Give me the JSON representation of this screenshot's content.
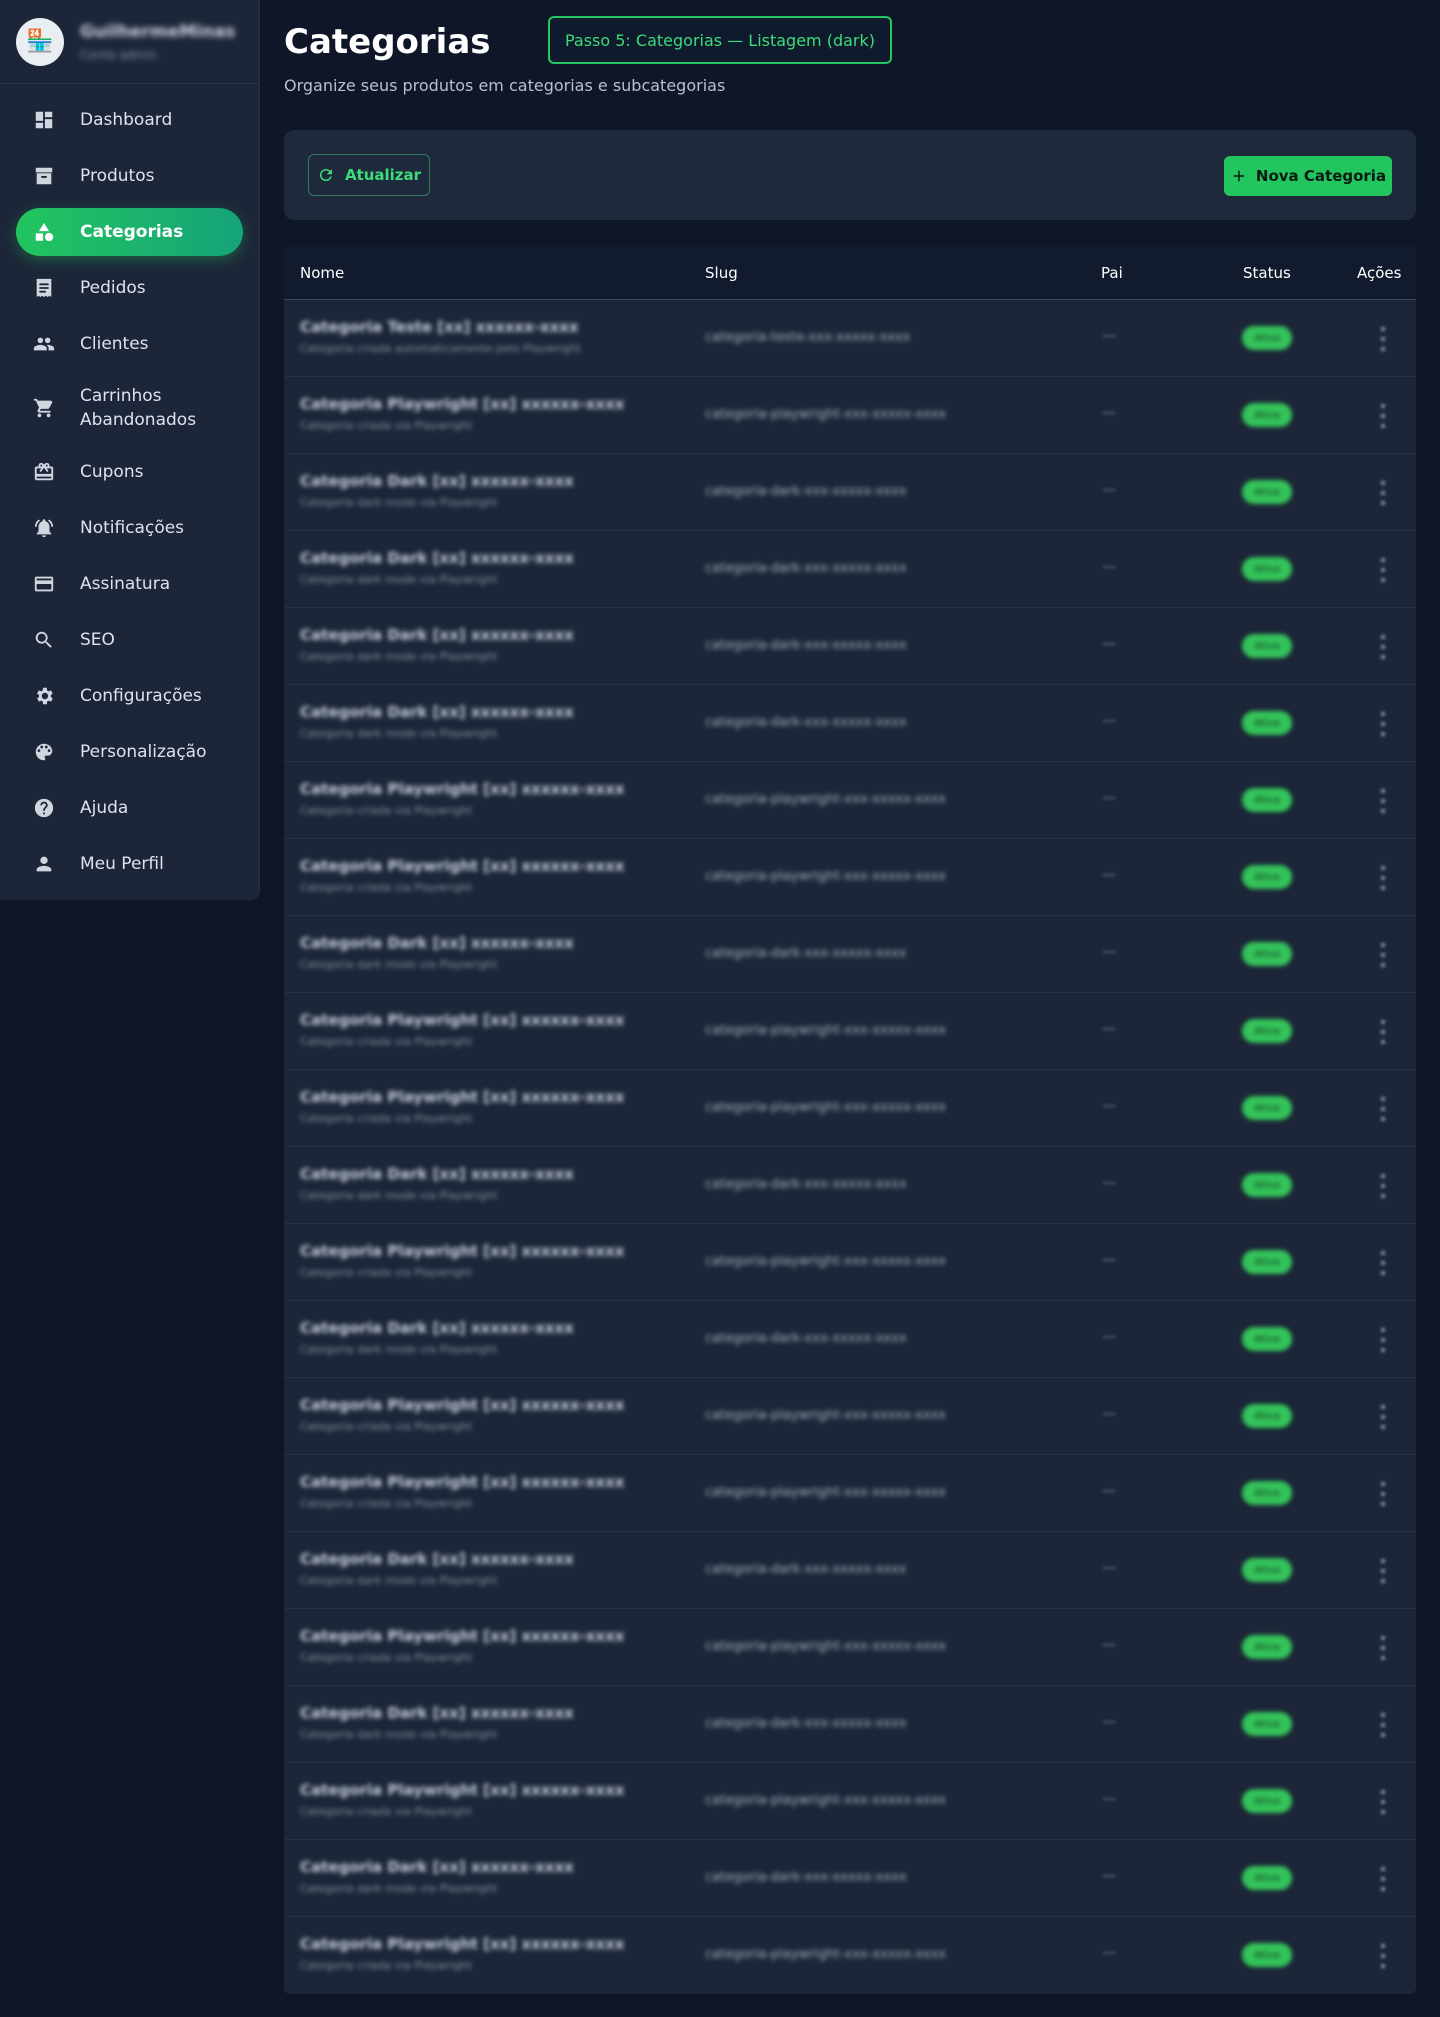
{
  "brand": {
    "name": "GuilhermeMinas",
    "subtitle": "Conta admin",
    "logo_icon": "store-logo"
  },
  "sidebar": {
    "items": [
      {
        "label": "Dashboard",
        "icon": "dashboard-icon",
        "active": false
      },
      {
        "label": "Produtos",
        "icon": "archive-icon",
        "active": false
      },
      {
        "label": "Categorias",
        "icon": "category-icon",
        "active": true
      },
      {
        "label": "Pedidos",
        "icon": "receipt-icon",
        "active": false
      },
      {
        "label": "Clientes",
        "icon": "people-icon",
        "active": false
      },
      {
        "label": "Carrinhos Abandonados",
        "icon": "cart-icon",
        "active": false
      },
      {
        "label": "Cupons",
        "icon": "gift-card-icon",
        "active": false
      },
      {
        "label": "Notificações",
        "icon": "bell-icon",
        "active": false
      },
      {
        "label": "Assinatura",
        "icon": "credit-card-icon",
        "active": false
      },
      {
        "label": "SEO",
        "icon": "search-icon",
        "active": false
      },
      {
        "label": "Configurações",
        "icon": "gear-icon",
        "active": false
      },
      {
        "label": "Personalização",
        "icon": "palette-icon",
        "active": false
      },
      {
        "label": "Ajuda",
        "icon": "help-icon",
        "active": false
      },
      {
        "label": "Meu Perfil",
        "icon": "person-icon",
        "active": false
      }
    ]
  },
  "header": {
    "title": "Categorias",
    "subtitle": "Organize seus produtos em categorias e subcategorias",
    "step_badge": "Passo 5: Categorias — Listagem (dark)"
  },
  "toolbar": {
    "refresh_label": "Atualizar",
    "new_label": "Nova Categoria"
  },
  "table": {
    "columns": [
      "Nome",
      "Slug",
      "Pai",
      "Status",
      "Ações"
    ],
    "rows": [
      {
        "name": "Categoria Teste [xx] xxxxxx-xxxx",
        "description": "Categoria criada automaticamente pelo Playwright",
        "slug": "categoria-teste-xxx-xxxxx-xxxx",
        "parent": "—",
        "status": "Ativa"
      },
      {
        "name": "Categoria Playwright [xx] xxxxxx-xxxx",
        "description": "Categoria criada via Playwright",
        "slug": "categoria-playwright-xxx-xxxxx-xxxx",
        "parent": "—",
        "status": "Ativa"
      },
      {
        "name": "Categoria Dark [xx] xxxxxx-xxxx",
        "description": "Categoria dark mode via Playwright",
        "slug": "categoria-dark-xxx-xxxxx-xxxx",
        "parent": "—",
        "status": "Ativa"
      },
      {
        "name": "Categoria Dark [xx] xxxxxx-xxxx",
        "description": "Categoria dark mode via Playwright",
        "slug": "categoria-dark-xxx-xxxxx-xxxx",
        "parent": "—",
        "status": "Ativa"
      },
      {
        "name": "Categoria Dark [xx] xxxxxx-xxxx",
        "description": "Categoria dark mode via Playwright",
        "slug": "categoria-dark-xxx-xxxxx-xxxx",
        "parent": "—",
        "status": "Ativa"
      },
      {
        "name": "Categoria Dark [xx] xxxxxx-xxxx",
        "description": "Categoria dark mode via Playwright",
        "slug": "categoria-dark-xxx-xxxxx-xxxx",
        "parent": "—",
        "status": "Ativa"
      },
      {
        "name": "Categoria Playwright [xx] xxxxxx-xxxx",
        "description": "Categoria criada via Playwright",
        "slug": "categoria-playwright-xxx-xxxxx-xxxx",
        "parent": "—",
        "status": "Ativa"
      },
      {
        "name": "Categoria Playwright [xx] xxxxxx-xxxx",
        "description": "Categoria criada via Playwright",
        "slug": "categoria-playwright-xxx-xxxxx-xxxx",
        "parent": "—",
        "status": "Ativa"
      },
      {
        "name": "Categoria Dark [xx] xxxxxx-xxxx",
        "description": "Categoria dark mode via Playwright",
        "slug": "categoria-dark-xxx-xxxxx-xxxx",
        "parent": "—",
        "status": "Ativa"
      },
      {
        "name": "Categoria Playwright [xx] xxxxxx-xxxx",
        "description": "Categoria criada via Playwright",
        "slug": "categoria-playwright-xxx-xxxxx-xxxx",
        "parent": "—",
        "status": "Ativa"
      },
      {
        "name": "Categoria Playwright [xx] xxxxxx-xxxx",
        "description": "Categoria criada via Playwright",
        "slug": "categoria-playwright-xxx-xxxxx-xxxx",
        "parent": "—",
        "status": "Ativa"
      },
      {
        "name": "Categoria Dark [xx] xxxxxx-xxxx",
        "description": "Categoria dark mode via Playwright",
        "slug": "categoria-dark-xxx-xxxxx-xxxx",
        "parent": "—",
        "status": "Ativa"
      },
      {
        "name": "Categoria Playwright [xx] xxxxxx-xxxx",
        "description": "Categoria criada via Playwright",
        "slug": "categoria-playwright-xxx-xxxxx-xxxx",
        "parent": "—",
        "status": "Ativa"
      },
      {
        "name": "Categoria Dark [xx] xxxxxx-xxxx",
        "description": "Categoria dark mode via Playwright",
        "slug": "categoria-dark-xxx-xxxxx-xxxx",
        "parent": "—",
        "status": "Ativa"
      },
      {
        "name": "Categoria Playwright [xx] xxxxxx-xxxx",
        "description": "Categoria criada via Playwright",
        "slug": "categoria-playwright-xxx-xxxxx-xxxx",
        "parent": "—",
        "status": "Ativa"
      },
      {
        "name": "Categoria Playwright [xx] xxxxxx-xxxx",
        "description": "Categoria criada via Playwright",
        "slug": "categoria-playwright-xxx-xxxxx-xxxx",
        "parent": "—",
        "status": "Ativa"
      },
      {
        "name": "Categoria Dark [xx] xxxxxx-xxxx",
        "description": "Categoria dark mode via Playwright",
        "slug": "categoria-dark-xxx-xxxxx-xxxx",
        "parent": "—",
        "status": "Ativa"
      },
      {
        "name": "Categoria Playwright [xx] xxxxxx-xxxx",
        "description": "Categoria criada via Playwright",
        "slug": "categoria-playwright-xxx-xxxxx-xxxx",
        "parent": "—",
        "status": "Ativa"
      },
      {
        "name": "Categoria Dark [xx] xxxxxx-xxxx",
        "description": "Categoria dark mode via Playwright",
        "slug": "categoria-dark-xxx-xxxxx-xxxx",
        "parent": "—",
        "status": "Ativa"
      },
      {
        "name": "Categoria Playwright [xx] xxxxxx-xxxx",
        "description": "Categoria criada via Playwright",
        "slug": "categoria-playwright-xxx-xxxxx-xxxx",
        "parent": "—",
        "status": "Ativa"
      },
      {
        "name": "Categoria Dark [xx] xxxxxx-xxxx",
        "description": "Categoria dark mode via Playwright",
        "slug": "categoria-dark-xxx-xxxxx-xxxx",
        "parent": "—",
        "status": "Ativa"
      },
      {
        "name": "Categoria Playwright [xx] xxxxxx-xxxx",
        "description": "Categoria criada via Playwright",
        "slug": "categoria-playwright-xxx-xxxxx-xxxx",
        "parent": "—",
        "status": "Ativa"
      }
    ]
  },
  "colors": {
    "background": "#0e1628",
    "surface": "#1e293b",
    "accent": "#22c55e",
    "text": "#e6ebf2"
  }
}
